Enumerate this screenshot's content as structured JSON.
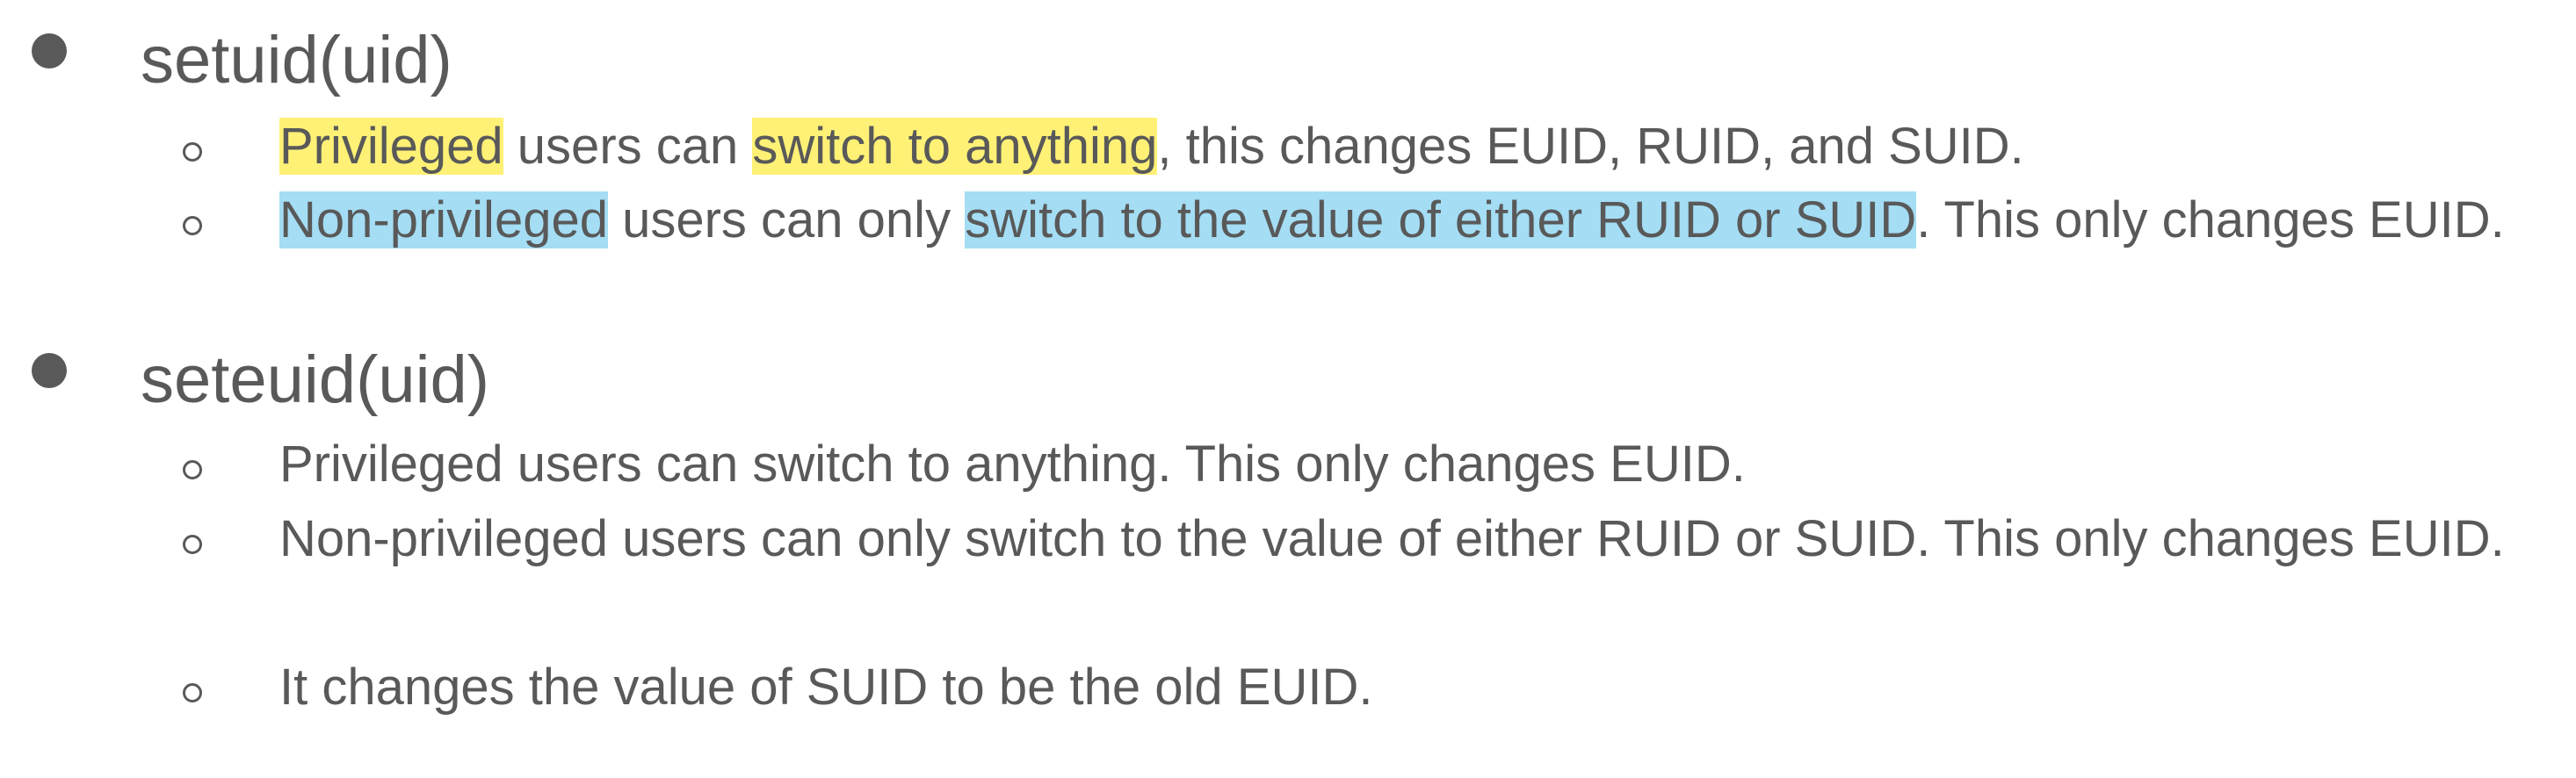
{
  "colors": {
    "text": "#595959",
    "highlight_yellow": "#fff176",
    "highlight_blue": "#a4ddf4"
  },
  "items": [
    {
      "heading": "setuid(uid)",
      "subitems": [
        {
          "segments": [
            {
              "text": "Privileged",
              "highlight": "yellow"
            },
            {
              "text": " users can ",
              "highlight": "none"
            },
            {
              "text": "switch to anything",
              "highlight": "yellow"
            },
            {
              "text": ", this changes EUID, RUID, and SUID.",
              "highlight": "none"
            }
          ]
        },
        {
          "segments": [
            {
              "text": "Non-privileged",
              "highlight": "blue"
            },
            {
              "text": " users can only ",
              "highlight": "none"
            },
            {
              "text": "switch to the value of either RUID or SUID",
              "highlight": "blue"
            },
            {
              "text": ". This only changes EUID.",
              "highlight": "none"
            }
          ]
        }
      ]
    },
    {
      "heading": "seteuid(uid)",
      "subitems": [
        {
          "text": "Privileged users can switch to anything. This only changes EUID."
        },
        {
          "text": "Non-privileged users can only switch to the value of either RUID or SUID. This only changes EUID."
        },
        {
          "text": "It changes the value of SUID to be the old EUID."
        }
      ]
    }
  ]
}
